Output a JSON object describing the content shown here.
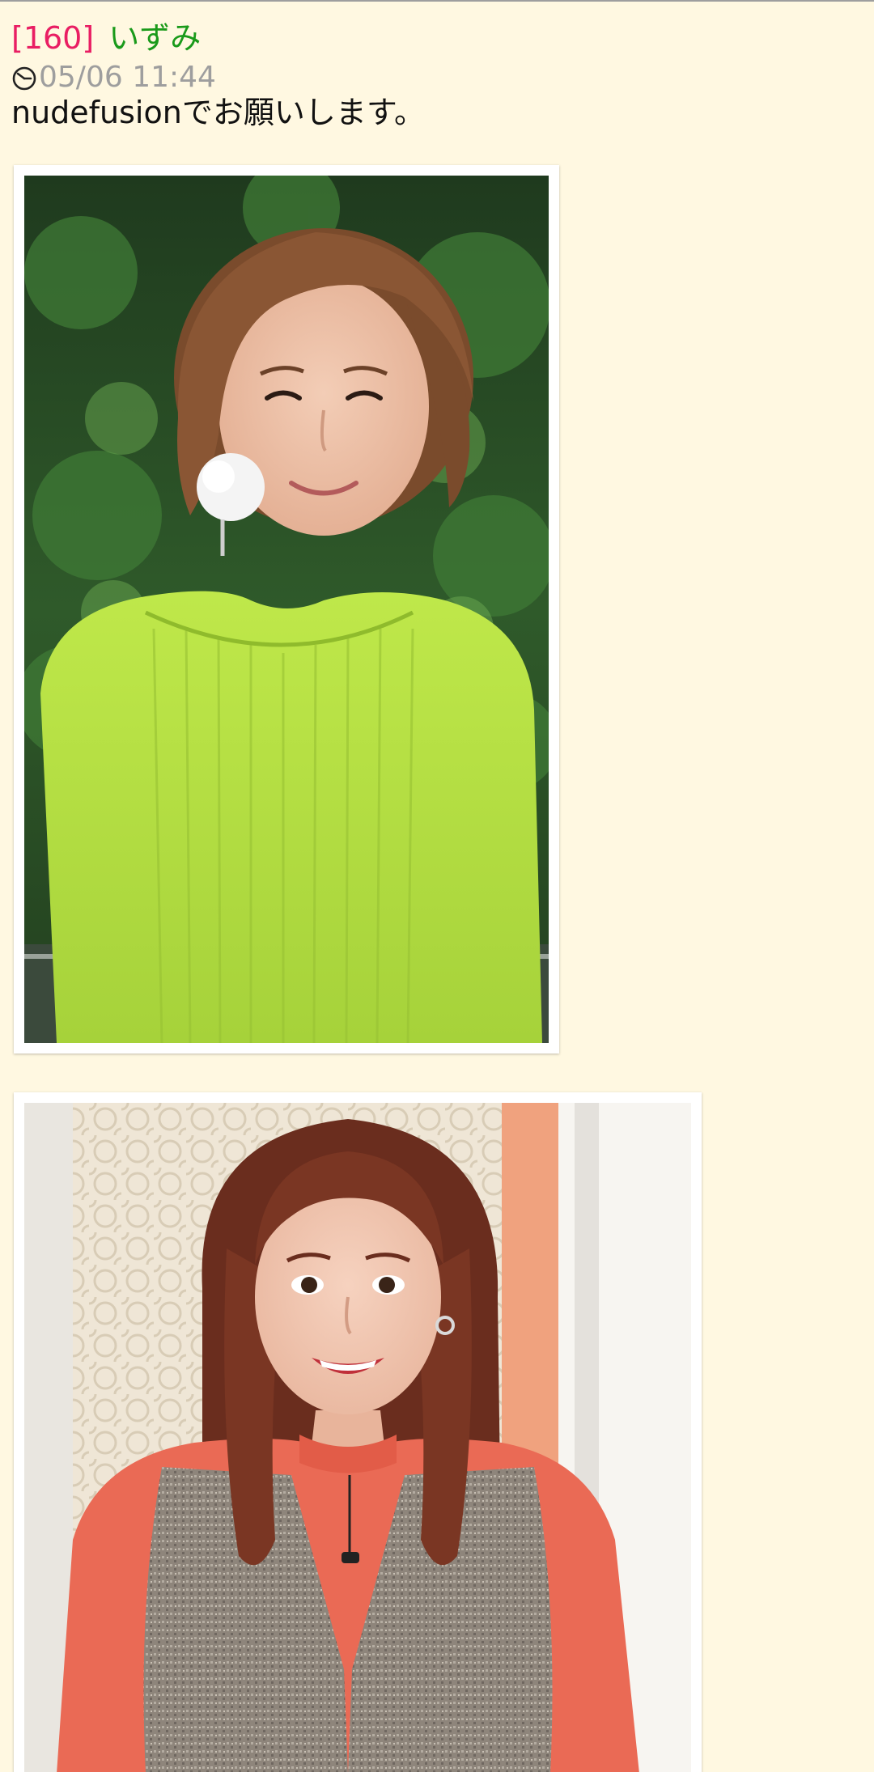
{
  "post": {
    "number": "[160]",
    "author": "いずみ",
    "timestamp": "05/06 11:44",
    "timestamp_icon": "clock-icon",
    "body": "nudefusionでお願いします。"
  },
  "attachments": [
    {
      "kind": "photo",
      "description_icon": "photo-woman-green-sweater"
    },
    {
      "kind": "photo",
      "description_icon": "photo-woman-coral-top-vest"
    }
  ],
  "colors": {
    "background": "#fff8e1",
    "post_number": "#e91e63",
    "author": "#1a9a1a",
    "timestamp": "#9e9e9e"
  }
}
